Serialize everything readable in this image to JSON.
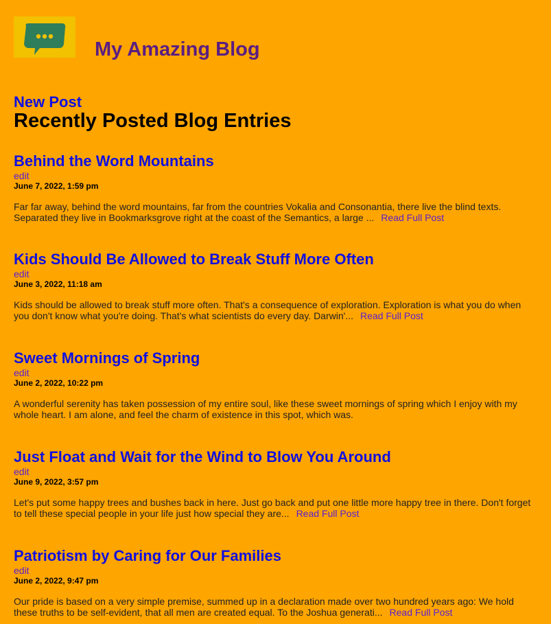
{
  "site": {
    "title": "My Amazing Blog",
    "logo_icon": "chat-bubble-icon",
    "colors": {
      "background": "#ffa500",
      "title": "#5a1e82",
      "link": "#1010e0",
      "visited_link": "#5a1ed0",
      "logo_bg": "#f2c100",
      "logo_bubble": "#2e7d5b"
    }
  },
  "nav": {
    "new_post_label": "New Post"
  },
  "section": {
    "title": "Recently Posted Blog Entries"
  },
  "entries": [
    {
      "title": "Behind the Word Mountains",
      "edit_label": "edit",
      "date": "June 7, 2022, 1:59 pm",
      "excerpt": "Far far away, behind the word mountains, far from the countries Vokalia and Consonantia, there live the blind texts. Separated they live in Bookmarksgrove right at the coast of the Semantics, a large ...",
      "read_more": "Read Full Post"
    },
    {
      "title": "Kids Should Be Allowed to Break Stuff More Often",
      "edit_label": "edit",
      "date": "June 3, 2022, 11:18 am",
      "excerpt": "Kids should be allowed to break stuff more often. That's a consequence of exploration. Exploration is what you do when you don't know what you're doing. That's what scientists do every day. Darwin'...",
      "read_more": "Read Full Post"
    },
    {
      "title": "Sweet Mornings of Spring",
      "edit_label": "edit",
      "date": "June 2, 2022, 10:22 pm",
      "excerpt": "A wonderful serenity has taken possession of my entire soul, like these sweet mornings of spring which I enjoy with my whole heart. I am alone, and feel the charm of existence in this spot, which was.",
      "read_more": ""
    },
    {
      "title": "Just Float and Wait for the Wind to Blow You Around",
      "edit_label": "edit",
      "date": "June 9, 2022, 3:57 pm",
      "excerpt": "Let's put some happy trees and bushes back in here. Just go back and put one little more happy tree in there. Don't forget to tell these special people in your life just how special they are...",
      "read_more": "Read Full Post"
    },
    {
      "title": "Patriotism by Caring for Our Families",
      "edit_label": "edit",
      "date": "June 2, 2022, 9:47 pm",
      "excerpt": "Our pride is based on a very simple premise, summed up in a declaration made over two hundred years ago: We hold these truths to be self-evident, that all men are created equal. To the Joshua generati...",
      "read_more": "Read Full Post"
    }
  ]
}
